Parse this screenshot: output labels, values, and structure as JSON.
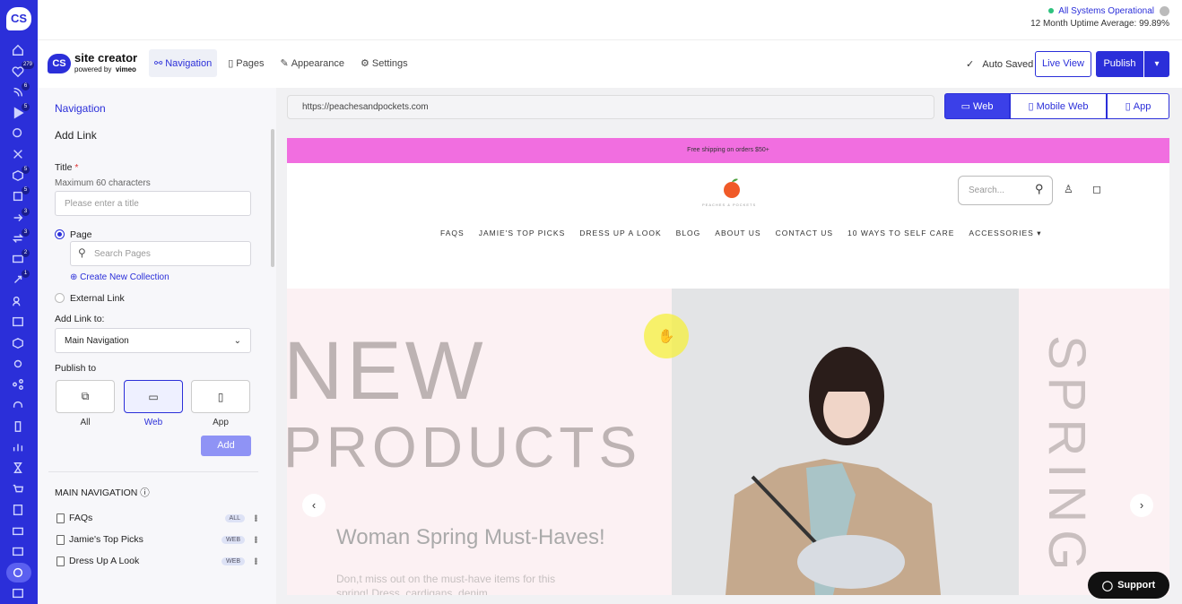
{
  "rail": {
    "logo": "CS",
    "badges": [
      "279",
      "6",
      "5",
      "5",
      "5",
      "3",
      "3",
      "2",
      "1"
    ]
  },
  "status": {
    "ok_text": "All Systems Operational",
    "uptime": "12 Month Uptime Average: 99.89%"
  },
  "brand": {
    "logo": "CS",
    "name": "site creator",
    "powered": "powered by",
    "vendor": "vimeo"
  },
  "topnav": {
    "tabs": [
      {
        "label": "Navigation",
        "icon": "navigation-icon"
      },
      {
        "label": "Pages",
        "icon": "page-icon"
      },
      {
        "label": "Appearance",
        "icon": "brush-icon"
      },
      {
        "label": "Settings",
        "icon": "gear-icon"
      }
    ]
  },
  "actions": {
    "saved": "Auto Saved",
    "live": "Live View",
    "publish": "Publish"
  },
  "sidebar": {
    "breadcrumb": "Navigation",
    "heading": "Add Link",
    "title_label": "Title",
    "title_hint": "Maximum 60 characters",
    "title_placeholder": "Please enter a title",
    "page_label": "Page",
    "search_placeholder": "Search Pages",
    "create_collection": "Create New Collection",
    "external_label": "External Link",
    "add_to_label": "Add Link to:",
    "add_to_value": "Main Navigation",
    "publish_label": "Publish to",
    "publish_options": [
      "All",
      "Web",
      "App"
    ],
    "add_button": "Add",
    "main_nav_title": "MAIN NAVIGATION",
    "nav_items": [
      {
        "label": "FAQs",
        "tag": "ALL"
      },
      {
        "label": "Jamie's Top Picks",
        "tag": "WEB"
      },
      {
        "label": "Dress Up A Look",
        "tag": "WEB"
      }
    ]
  },
  "preview": {
    "url": "https://peachesandpockets.com",
    "devices": [
      "Web",
      "Mobile Web",
      "App"
    ]
  },
  "site": {
    "shipping": "Free shipping on orders $50+",
    "search_placeholder": "Search...",
    "logo_text": "PEACHES & POCKETS",
    "menu": [
      "FAQS",
      "JAMIE'S TOP PICKS",
      "DRESS UP A LOOK",
      "BLOG",
      "ABOUT US",
      "CONTACT US",
      "10 WAYS TO SELF CARE",
      "ACCESSORIES"
    ],
    "hero_line1": "NEW",
    "hero_line2": "PRODUCTS",
    "hero_side": "SPRING",
    "hero_heading": "Woman Spring Must-Haves!",
    "hero_text": "Don,t miss out on the must-have items for this spring! Dress, cardigans, denim"
  },
  "support": "Support"
}
